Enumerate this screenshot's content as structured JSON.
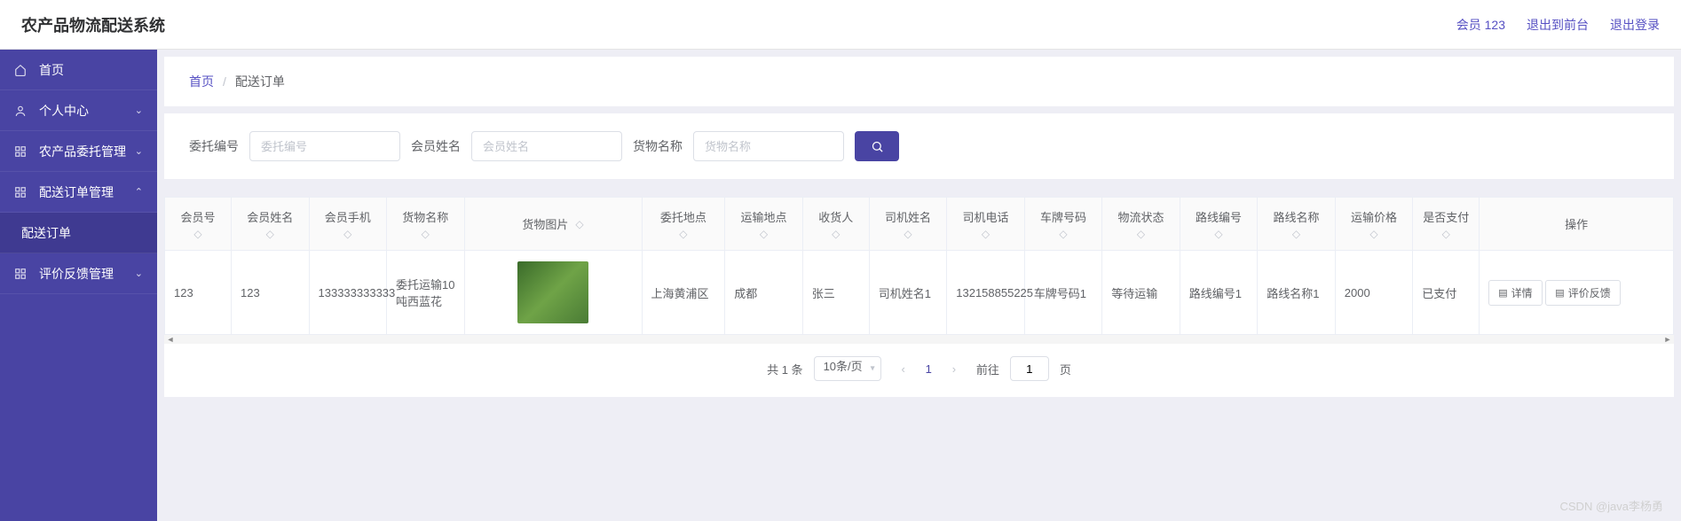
{
  "header": {
    "app_title": "农产品物流配送系统",
    "member_label": "会员 123",
    "to_front": "退出到前台",
    "logout": "退出登录"
  },
  "sidebar": {
    "items": [
      {
        "label": "首页",
        "icon": "home",
        "expandable": false
      },
      {
        "label": "个人中心",
        "icon": "user",
        "expandable": true,
        "open": false
      },
      {
        "label": "农产品委托管理",
        "icon": "grid",
        "expandable": true,
        "open": false
      },
      {
        "label": "配送订单管理",
        "icon": "grid",
        "expandable": true,
        "open": true
      },
      {
        "label": "配送订单",
        "icon": "",
        "submenu": true
      },
      {
        "label": "评价反馈管理",
        "icon": "grid",
        "expandable": true,
        "open": false
      }
    ]
  },
  "breadcrumb": {
    "home": "首页",
    "current": "配送订单"
  },
  "search": {
    "field1_label": "委托编号",
    "field1_placeholder": "委托编号",
    "field2_label": "会员姓名",
    "field2_placeholder": "会员姓名",
    "field3_label": "货物名称",
    "field3_placeholder": "货物名称"
  },
  "table": {
    "columns": [
      "会员号",
      "会员姓名",
      "会员手机",
      "货物名称",
      "货物图片",
      "委托地点",
      "运输地点",
      "收货人",
      "司机姓名",
      "司机电话",
      "车牌号码",
      "物流状态",
      "路线编号",
      "路线名称",
      "运输价格",
      "是否支付",
      "操作"
    ],
    "rows": [
      {
        "member_no": "123",
        "member_name": "123",
        "member_phone": "133333333333",
        "goods_name": "委托运输10吨西蓝花",
        "entrust_place": "上海黄浦区",
        "transport_place": "成都",
        "receiver": "张三",
        "driver_name": "司机姓名1",
        "driver_phone": "132158855225",
        "plate": "车牌号码1",
        "logistics_status": "等待运输",
        "route_no": "路线编号1",
        "route_name": "路线名称1",
        "price": "2000",
        "paid": "已支付"
      }
    ],
    "actions": {
      "detail": "详情",
      "feedback": "评价反馈"
    }
  },
  "pagination": {
    "total_text": "共 1 条",
    "per_page": "10条/页",
    "current": "1",
    "goto_label_before": "前往",
    "goto_value": "1",
    "goto_label_after": "页"
  },
  "watermark": "CSDN @java李杨勇"
}
